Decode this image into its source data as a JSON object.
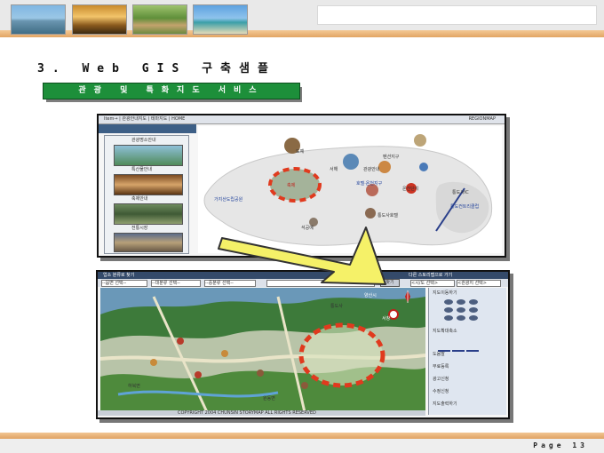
{
  "header": {
    "thumbnails": [
      "beach-pier",
      "sunset-palms",
      "resort-garden",
      "tropical-beach"
    ]
  },
  "title": "3. Web GIS 구축샘플",
  "subtitle": "관광 및 특화지도 서비스",
  "screen1": {
    "toolbar_left": "Item→ | 관광안내지도 | 테마지도 | HOME",
    "toolbar_right": "REGIONMAP",
    "sidebar_items": [
      "관광명소안내",
      "특산물안내",
      "축제안내",
      "전통시장"
    ],
    "map_labels": {
      "label_a": "도예",
      "label_b": "서해",
      "label_c": "관광안내",
      "label_d": "펜션지구",
      "label_e": "호텔·온천지구",
      "label_f": "가지산도립공원",
      "label_g": "축제",
      "label_h": "온천단지",
      "label_i": "통도사IC",
      "label_j": "통도사호텔",
      "label_k": "통도컨트리클럽",
      "label_l": "석공예"
    }
  },
  "screen2": {
    "search_title": "업소 분류로 찾기",
    "search_right_title": "다른 스토리맵으로 가기",
    "select_1": "--읍면 선택--",
    "select_2": "--대분류 선택--",
    "select_3": "--중분류 선택--",
    "search_button": "찾기",
    "select_right_1": "<시/도 선택>",
    "select_right_2": "<관광지 선택>",
    "map_labels": {
      "label_a": "양산시",
      "label_b": "통도사",
      "label_c": "서창",
      "label_d": "하북면",
      "label_e": "원동면"
    },
    "side_menu": [
      "지도이동하기",
      "지도확대축소",
      "도움말",
      "무료등록",
      "광고신청",
      "수정신청",
      "지도출력하기"
    ],
    "copyright": "COPYRIGHT 2004 CHUNSIN STORYMAP ALL RIGHTS RESERVED"
  },
  "footer": {
    "page": "Page 13"
  }
}
